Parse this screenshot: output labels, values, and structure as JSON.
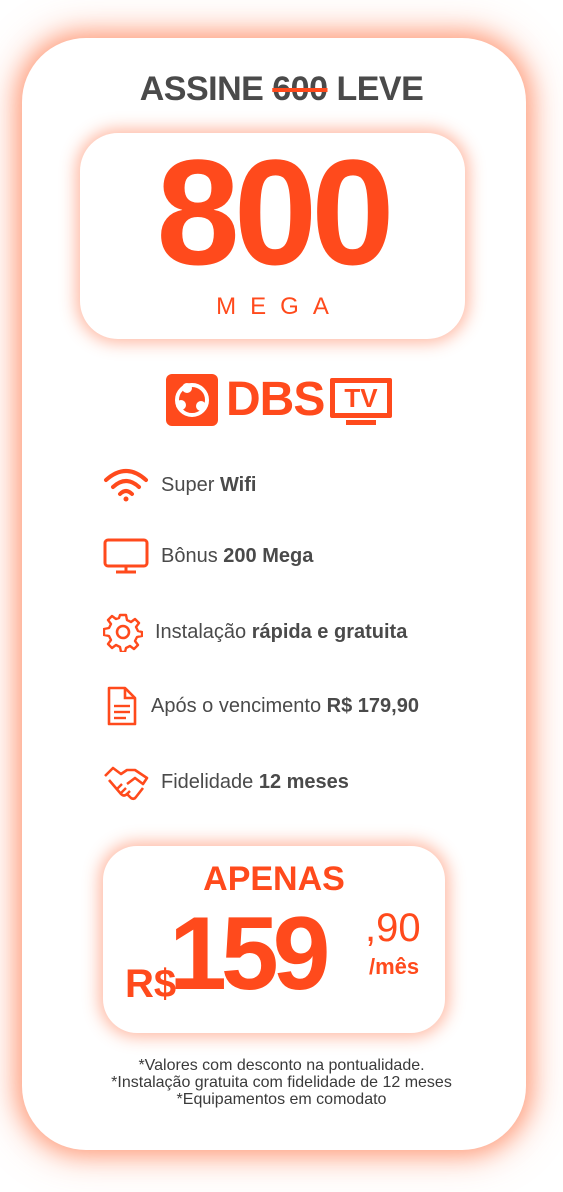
{
  "headline": {
    "prefix": "ASSINE",
    "struck": "600",
    "suffix": "LEVE"
  },
  "speed": {
    "value": "800",
    "unit": "MEGA"
  },
  "brand": {
    "name": "DBS",
    "sub": "TV"
  },
  "features": [
    {
      "icon": "wifi-icon",
      "text": "Super ",
      "bold": "Wifi"
    },
    {
      "icon": "tv-icon",
      "text": "Bônus ",
      "bold": "200 Mega"
    },
    {
      "icon": "gear-icon",
      "text": "Instalação ",
      "bold": "rápida e gratuita"
    },
    {
      "icon": "document-icon",
      "text": "Após o vencimento ",
      "bold": "R$ 179,90"
    },
    {
      "icon": "handshake-icon",
      "text": "Fidelidade ",
      "bold": "12 meses"
    }
  ],
  "price": {
    "label": "APENAS",
    "currency": "R$",
    "integer": "159",
    "cents": ",90",
    "period": "/mês"
  },
  "notes": [
    "*Valores com desconto na pontualidade.",
    "*Instalação gratuita com fidelidade de 12 meses",
    "*Equipamentos em comodato"
  ],
  "colors": {
    "accent": "#ff4a1c",
    "text": "#4a4a4a"
  }
}
